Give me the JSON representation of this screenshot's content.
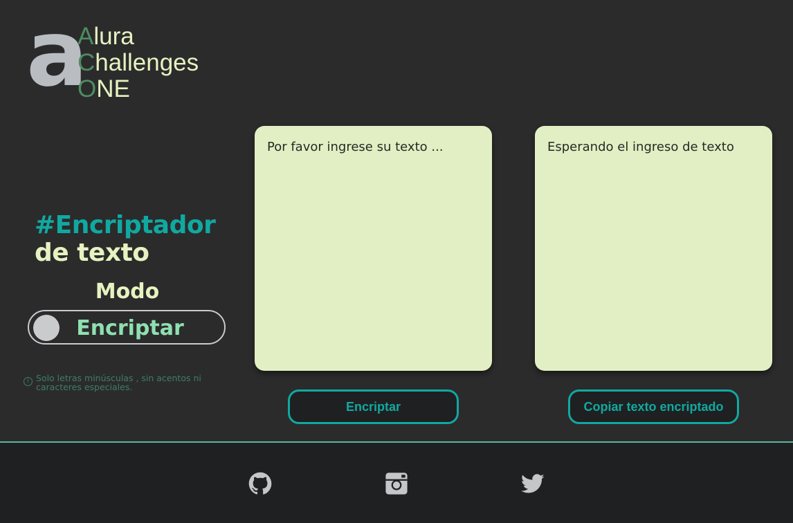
{
  "logo": {
    "mark": "a",
    "lines": [
      {
        "initial": "A",
        "rest": "lura"
      },
      {
        "initial": "C",
        "rest": "hallenges"
      },
      {
        "initial": "O",
        "rest": "NE"
      }
    ]
  },
  "heading": {
    "line1": "#Encriptador",
    "line2": "de texto"
  },
  "mode": {
    "label": "Modo",
    "toggle_text": "Encriptar"
  },
  "hint": {
    "icon": "info-icon",
    "text": "Solo letras minúsculas , sin acentos ni caracteres especiales."
  },
  "input_panel": {
    "placeholder": "Por favor ingrese su texto ...",
    "value": ""
  },
  "output_panel": {
    "text": "Esperando el ingreso de texto"
  },
  "buttons": {
    "encrypt_label": "Encriptar",
    "copy_label": "Copiar texto encriptado"
  },
  "footer": {
    "icons": [
      "github-icon",
      "instagram-icon",
      "twitter-icon"
    ]
  },
  "colors": {
    "background": "#2b2b2c",
    "accent": "#10a9a1",
    "panel": "#e2efc4",
    "text_light": "#e6f2c0",
    "footer": "#1f2021"
  }
}
